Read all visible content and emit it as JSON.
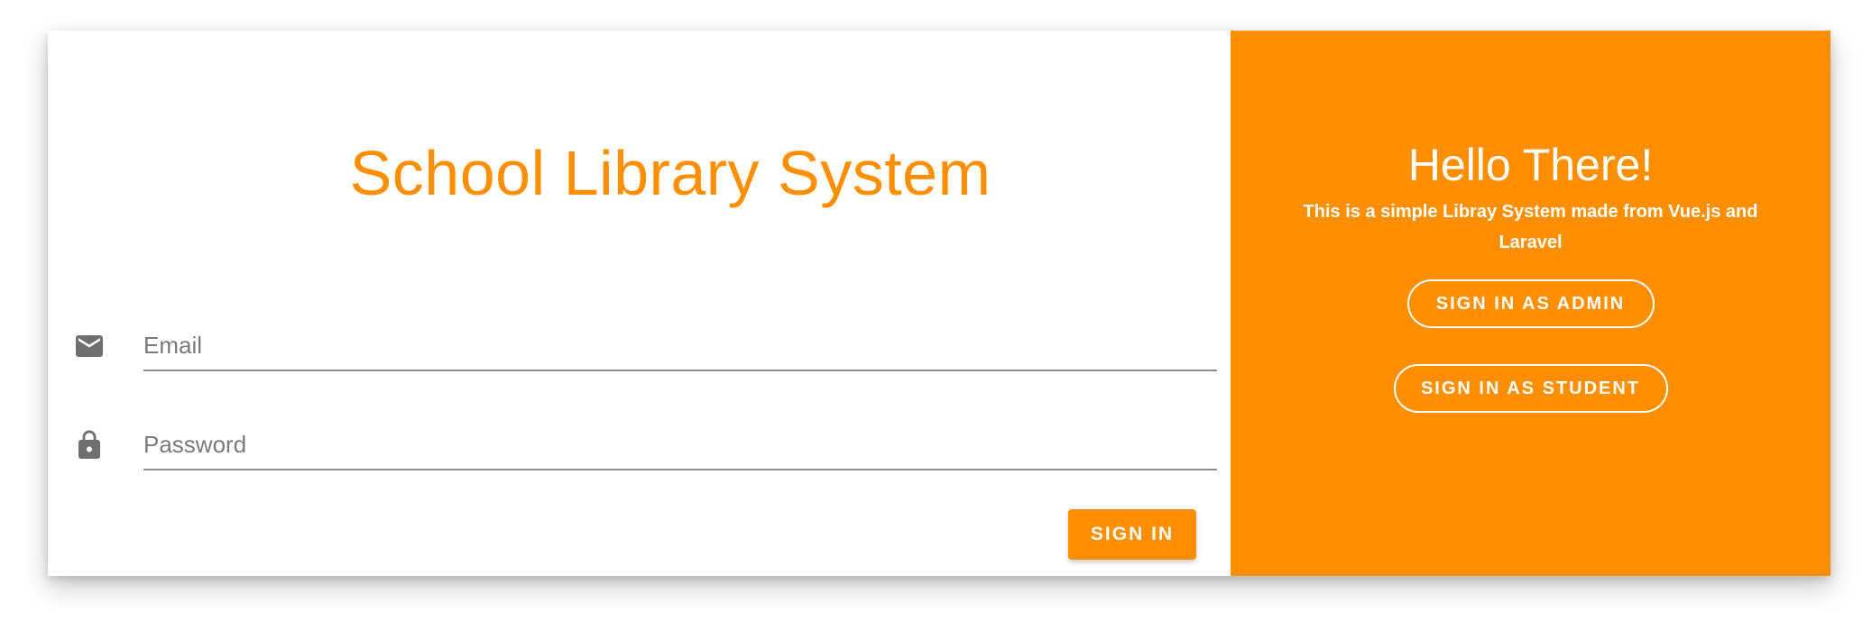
{
  "login": {
    "title": "School Library System",
    "email": {
      "placeholder": "Email",
      "value": "",
      "icon": "mail-icon"
    },
    "password": {
      "placeholder": "Password",
      "value": "",
      "icon": "lock-icon"
    },
    "signin_label": "SIGN IN"
  },
  "welcome": {
    "heading": "Hello There!",
    "subtitle": "This is a simple Libray System made from Vue.js and Laravel",
    "admin_label": "SIGN IN AS ADMIN",
    "student_label": "SIGN IN AS STUDENT"
  },
  "colors": {
    "accent": "#ff8f00",
    "icon": "#6f6f6f",
    "underline": "#8c8c8c"
  }
}
